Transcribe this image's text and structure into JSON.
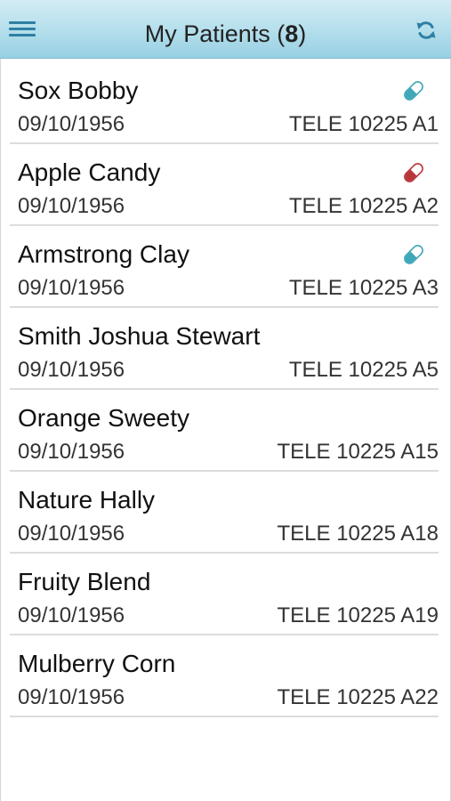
{
  "header": {
    "title": "My Patients (",
    "count": "8",
    "title_suffix": ")",
    "menu_icon": "hamburger-menu-icon",
    "refresh_icon": "refresh-icon",
    "bar_color": "#b9e1ed",
    "icon_color": "#2f7fa4"
  },
  "pill_colors": {
    "teal": "#3ea7b8",
    "red": "#b8363a"
  },
  "patients": [
    {
      "name": "Sox Bobby",
      "dob": "09/10/1956",
      "location": "TELE 10225 A1",
      "pill": "teal"
    },
    {
      "name": "Apple Candy",
      "dob": "09/10/1956",
      "location": "TELE 10225 A2",
      "pill": "red"
    },
    {
      "name": "Armstrong Clay",
      "dob": "09/10/1956",
      "location": "TELE 10225 A3",
      "pill": "teal"
    },
    {
      "name": "Smith Joshua Stewart",
      "dob": "09/10/1956",
      "location": "TELE 10225 A5",
      "pill": ""
    },
    {
      "name": "Orange Sweety",
      "dob": "09/10/1956",
      "location": "TELE 10225 A15",
      "pill": ""
    },
    {
      "name": "Nature Hally",
      "dob": "09/10/1956",
      "location": "TELE 10225 A18",
      "pill": ""
    },
    {
      "name": "Fruity Blend",
      "dob": "09/10/1956",
      "location": "TELE 10225 A19",
      "pill": ""
    },
    {
      "name": "Mulberry Corn",
      "dob": "09/10/1956",
      "location": "TELE 10225 A22",
      "pill": ""
    }
  ]
}
